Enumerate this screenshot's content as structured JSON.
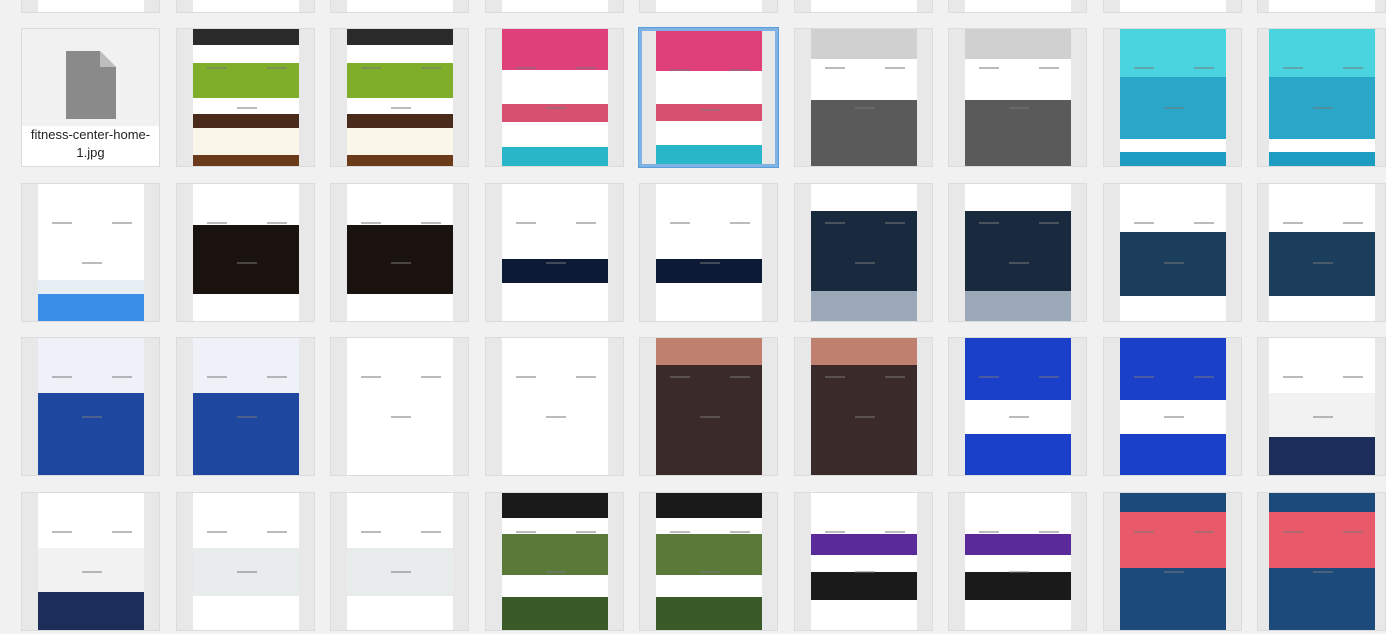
{
  "window": {
    "title": ""
  },
  "files": [
    {
      "row": 0,
      "col": 0,
      "theme": "gold-header"
    },
    {
      "row": 0,
      "col": 1,
      "theme": "dark-blue-top"
    },
    {
      "row": 0,
      "col": 2,
      "theme": "dark-blue-top"
    },
    {
      "row": 0,
      "col": 3,
      "theme": "black-top"
    },
    {
      "row": 0,
      "col": 4,
      "theme": "white-plain"
    },
    {
      "row": 0,
      "col": 5,
      "theme": "white-red"
    },
    {
      "row": 0,
      "col": 6,
      "theme": "white-plain"
    },
    {
      "row": 0,
      "col": 7,
      "theme": "teal-top"
    },
    {
      "row": 0,
      "col": 8,
      "theme": "dark-top"
    },
    {
      "row": 1,
      "col": 0,
      "kind": "file",
      "label": "fitness-center-home-1.jpg"
    },
    {
      "row": 1,
      "col": 1,
      "theme": "food-green"
    },
    {
      "row": 1,
      "col": 2,
      "theme": "food-green"
    },
    {
      "row": 1,
      "col": 3,
      "theme": "pink-teal"
    },
    {
      "row": 1,
      "col": 4,
      "theme": "pink-teal",
      "selected": true
    },
    {
      "row": 1,
      "col": 5,
      "theme": "bw-library"
    },
    {
      "row": 1,
      "col": 6,
      "theme": "bw-library"
    },
    {
      "row": 1,
      "col": 7,
      "theme": "teal-business"
    },
    {
      "row": 1,
      "col": 8,
      "theme": "teal-business"
    },
    {
      "row": 2,
      "col": 0,
      "theme": "white-blue-footer"
    },
    {
      "row": 2,
      "col": 1,
      "theme": "restaurant-dark"
    },
    {
      "row": 2,
      "col": 2,
      "theme": "restaurant-dark"
    },
    {
      "row": 2,
      "col": 3,
      "theme": "interior-navy"
    },
    {
      "row": 2,
      "col": 4,
      "theme": "interior-navy"
    },
    {
      "row": 2,
      "col": 5,
      "theme": "navy-map"
    },
    {
      "row": 2,
      "col": 6,
      "theme": "navy-map"
    },
    {
      "row": 2,
      "col": 7,
      "theme": "navy-manufacturing"
    },
    {
      "row": 2,
      "col": 8,
      "theme": "navy-manufacturing"
    },
    {
      "row": 3,
      "col": 0,
      "theme": "blue-services"
    },
    {
      "row": 3,
      "col": 1,
      "theme": "blue-services"
    },
    {
      "row": 3,
      "col": 2,
      "theme": "portrait-purple"
    },
    {
      "row": 3,
      "col": 3,
      "theme": "portrait-purple"
    },
    {
      "row": 3,
      "col": 4,
      "theme": "barber-dark"
    },
    {
      "row": 3,
      "col": 5,
      "theme": "barber-dark"
    },
    {
      "row": 3,
      "col": 6,
      "theme": "royal-blue"
    },
    {
      "row": 3,
      "col": 7,
      "theme": "royal-blue"
    },
    {
      "row": 3,
      "col": 8,
      "theme": "wedding-navy"
    },
    {
      "row": 4,
      "col": 0,
      "theme": "wedding-navy"
    },
    {
      "row": 4,
      "col": 1,
      "theme": "about-me"
    },
    {
      "row": 4,
      "col": 2,
      "theme": "about-me"
    },
    {
      "row": 4,
      "col": 3,
      "theme": "farm-green"
    },
    {
      "row": 4,
      "col": 4,
      "theme": "farm-green"
    },
    {
      "row": 4,
      "col": 5,
      "theme": "purple-event"
    },
    {
      "row": 4,
      "col": 6,
      "theme": "purple-event"
    },
    {
      "row": 4,
      "col": 7,
      "theme": "red-blue"
    },
    {
      "row": 4,
      "col": 8,
      "theme": "red-blue"
    }
  ],
  "themes": {
    "gold-header": [
      [
        "#ffffff",
        0,
        55
      ],
      [
        "#d8a044",
        55,
        60
      ],
      [
        "#ffffff",
        60,
        100
      ]
    ],
    "dark-blue-top": [
      [
        "#2d3f5c",
        0,
        40
      ],
      [
        "#ffffff",
        40,
        100
      ]
    ],
    "black-top": [
      [
        "#111111",
        0,
        70
      ],
      [
        "#ffffff",
        70,
        100
      ]
    ],
    "white-plain": [
      [
        "#ffffff",
        0,
        100
      ]
    ],
    "white-red": [
      [
        "#ffffff",
        0,
        50
      ],
      [
        "#e05050",
        50,
        54
      ],
      [
        "#ffffff",
        54,
        100
      ]
    ],
    "teal-top": [
      [
        "#1c5a6b",
        0,
        60
      ],
      [
        "#ffffff",
        60,
        100
      ]
    ],
    "dark-top": [
      [
        "#222a36",
        0,
        80
      ],
      [
        "#ffffff",
        80,
        100
      ]
    ],
    "food-green": [
      [
        "#2a2a2a",
        0,
        12
      ],
      [
        "#ffffff",
        12,
        25
      ],
      [
        "#7fae2b",
        25,
        50
      ],
      [
        "#ffffff",
        50,
        62
      ],
      [
        "#4a2a1a",
        62,
        72
      ],
      [
        "#fbf6ea",
        72,
        92
      ],
      [
        "#6b3a1a",
        92,
        100
      ]
    ],
    "pink-teal": [
      [
        "#e0407a",
        0,
        30
      ],
      [
        "#ffffff",
        30,
        55
      ],
      [
        "#d85070",
        55,
        68
      ],
      [
        "#ffffff",
        68,
        86
      ],
      [
        "#28b6c8",
        86,
        100
      ]
    ],
    "bw-library": [
      [
        "#d0d0d0",
        0,
        22
      ],
      [
        "#ffffff",
        22,
        52
      ],
      [
        "#5a5a5a",
        52,
        100
      ]
    ],
    "teal-business": [
      [
        "#4ad4e0",
        0,
        35
      ],
      [
        "#2aa6c8",
        35,
        80
      ],
      [
        "#ffffff",
        80,
        90
      ],
      [
        "#1c9cc0",
        90,
        100
      ]
    ],
    "white-blue-footer": [
      [
        "#ffffff",
        0,
        70
      ],
      [
        "#e8eef5",
        70,
        80
      ],
      [
        "#3a8ee8",
        80,
        100
      ]
    ],
    "restaurant-dark": [
      [
        "#ffffff",
        0,
        30
      ],
      [
        "#1a120e",
        30,
        80
      ],
      [
        "#ffffff",
        80,
        100
      ]
    ],
    "interior-navy": [
      [
        "#ffffff",
        0,
        55
      ],
      [
        "#0c1a36",
        55,
        72
      ],
      [
        "#ffffff",
        72,
        100
      ]
    ],
    "navy-map": [
      [
        "#ffffff",
        0,
        20
      ],
      [
        "#1a2a3e",
        20,
        78
      ],
      [
        "#9aa8b8",
        78,
        100
      ]
    ],
    "navy-manufacturing": [
      [
        "#ffffff",
        0,
        35
      ],
      [
        "#1b3e5c",
        35,
        82
      ],
      [
        "#ffffff",
        82,
        100
      ]
    ],
    "blue-services": [
      [
        "#eef2f8",
        0,
        40
      ],
      [
        "#1e48a0",
        40,
        100
      ]
    ],
    "portrait-purple": [
      [
        "#ffffff",
        0,
        62
      ],
      [
        "#ffffff",
        62,
        100
      ]
    ],
    "barber-dark": [
      [
        "#c08070",
        0,
        20
      ],
      [
        "#3a2a2a",
        20,
        100
      ]
    ],
    "royal-blue": [
      [
        "#1a3fc8",
        0,
        45
      ],
      [
        "#ffffff",
        45,
        70
      ],
      [
        "#1a3fc8",
        70,
        100
      ]
    ],
    "wedding-navy": [
      [
        "#ffffff",
        0,
        40
      ],
      [
        "#f2f2f2",
        40,
        72
      ],
      [
        "#1c2d5a",
        72,
        100
      ]
    ],
    "about-me": [
      [
        "#ffffff",
        0,
        40
      ],
      [
        "#e8ecec",
        40,
        75
      ],
      [
        "#ffffff",
        75,
        100
      ]
    ],
    "farm-green": [
      [
        "#1a1a1a",
        0,
        18
      ],
      [
        "#ffffff",
        18,
        30
      ],
      [
        "#5a7a3a",
        30,
        60
      ],
      [
        "#ffffff",
        60,
        76
      ],
      [
        "#3a5a2a",
        76,
        100
      ]
    ],
    "purple-event": [
      [
        "#ffffff",
        0,
        30
      ],
      [
        "#5a2a9a",
        30,
        45
      ],
      [
        "#ffffff",
        45,
        58
      ],
      [
        "#1a1a1a",
        58,
        78
      ],
      [
        "#ffffff",
        78,
        100
      ]
    ],
    "red-blue": [
      [
        "#1c4a7a",
        0,
        14
      ],
      [
        "#e85a6a",
        14,
        55
      ],
      [
        "#1c4a7a",
        55,
        100
      ]
    ]
  }
}
